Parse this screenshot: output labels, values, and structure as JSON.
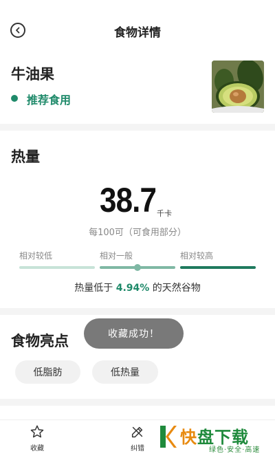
{
  "header": {
    "title": "食物详情",
    "back_icon": "back-circle-icon"
  },
  "food": {
    "name": "牛油果",
    "recommendation": "推荐食用",
    "recommendation_color": "#1f8a6a"
  },
  "energy": {
    "section_title": "热量",
    "value": "38.7",
    "unit": "千卡",
    "per": "每100可（可食用部分）",
    "levels": [
      "相对较低",
      "相对一般",
      "相对较高"
    ],
    "level_position": 0.5,
    "compare_prefix": "热量低于 ",
    "compare_value": "4.94%",
    "compare_suffix": " 的天然谷物"
  },
  "highlights": {
    "section_title": "食物亮点",
    "tags": [
      "低脂肪",
      "低热量"
    ]
  },
  "toast": "收藏成功！",
  "bottom_bar": {
    "items": [
      {
        "label": "收藏",
        "icon": "star-icon"
      },
      {
        "label": "纠错",
        "icon": "edit-icon"
      }
    ]
  },
  "watermark": {
    "main_a": "快",
    "main_b": "盘下载",
    "sub": "绿色·安全·高速"
  }
}
